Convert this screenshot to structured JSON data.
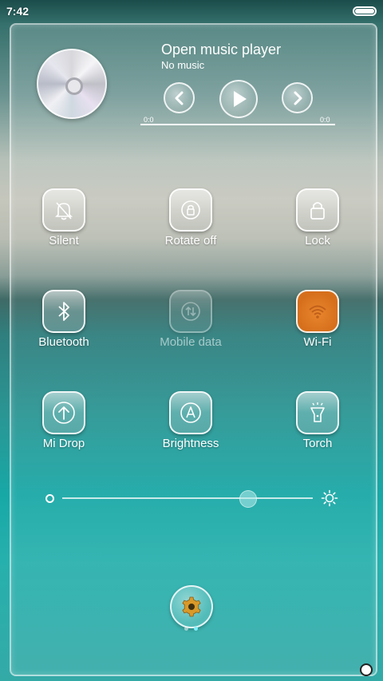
{
  "status": {
    "time": "7:42",
    "battery_icon": "battery-icon"
  },
  "music": {
    "title": "Open music player",
    "subtitle": "No music",
    "time_elapsed": "0:0",
    "time_total": "0:0",
    "progress": 1.0,
    "icons": {
      "album": "cd-disc-icon",
      "prev": "chevron-left-icon",
      "play": "play-icon",
      "next": "chevron-right-icon"
    }
  },
  "toggles": [
    {
      "label": "Silent",
      "icon": "bell-off-icon",
      "state": "off"
    },
    {
      "label": "Rotate off",
      "icon": "rotate-lock-icon",
      "state": "off"
    },
    {
      "label": "Lock",
      "icon": "lock-icon",
      "state": "off"
    },
    {
      "label": "Bluetooth",
      "icon": "bluetooth-icon",
      "state": "off"
    },
    {
      "label": "Mobile data",
      "icon": "mobile-data-icon",
      "state": "disabled"
    },
    {
      "label": "Wi-Fi",
      "icon": "wifi-icon",
      "state": "on"
    },
    {
      "label": "Mi Drop",
      "icon": "mi-drop-icon",
      "state": "off"
    },
    {
      "label": "Brightness",
      "icon": "auto-brightness-icon",
      "state": "off"
    },
    {
      "label": "Torch",
      "icon": "torch-icon",
      "state": "off"
    }
  ],
  "brightness_slider": {
    "value": 0.74,
    "min_icon": "dim-icon",
    "max_icon": "sun-icon"
  },
  "settings": {
    "icon": "gear-icon"
  },
  "pager": {
    "pages": 2,
    "current": 2
  },
  "colors": {
    "active_toggle": "#e07a25",
    "pager_active": "#7ef0ff",
    "gear": "#d99a2a"
  }
}
